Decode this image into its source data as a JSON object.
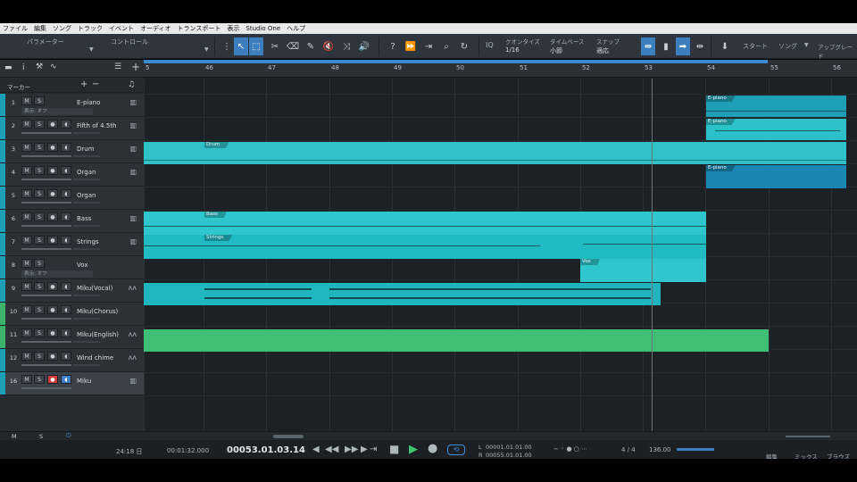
{
  "menu": [
    "ファイル",
    "編集",
    "ソング",
    "トラック",
    "イベント",
    "オーディオ",
    "トランスポート",
    "表示",
    "Studio One",
    "ヘルプ"
  ],
  "toolbar": {
    "parameter_label": "パラメーター",
    "control_label": "コントロール",
    "quantize_label": "クオンタイズ",
    "quantize_value": "1/16",
    "timebase_label": "タイムベース",
    "timebase_value": "小節",
    "snap_label": "スナップ",
    "snap_value": "適応",
    "iq_label": "IQ",
    "start_label": "スタート",
    "song_label": "ソング",
    "upgrade_label": "アップグレード"
  },
  "left_panel": {
    "marker_label": "マーカー",
    "tracks": [
      {
        "num": "1",
        "name": "E-piano",
        "color": "#1aa1b8",
        "sub": "表示: オフ",
        "icon": "keyboard-icon"
      },
      {
        "num": "2",
        "name": "Fifth of 4.5th",
        "color": "#1aa1b8",
        "icon": "keyboard-icon"
      },
      {
        "num": "3",
        "name": "Drum",
        "color": "#1aa1b8",
        "icon": "keyboard-icon"
      },
      {
        "num": "4",
        "name": "Organ",
        "color": "#1aa1b8",
        "icon": "keyboard-icon"
      },
      {
        "num": "5",
        "name": "Organ",
        "color": "#1aa1b8",
        "icon": ""
      },
      {
        "num": "6",
        "name": "Bass",
        "color": "#1aa1b8",
        "icon": "keyboard-icon"
      },
      {
        "num": "7",
        "name": "Strings",
        "color": "#1aa1b8",
        "icon": "keyboard-icon"
      },
      {
        "num": "8",
        "name": "Vox",
        "color": "#1aa1b8",
        "sub": "表示: オフ",
        "icon": ""
      },
      {
        "num": "9",
        "name": "Miku(Vocal)",
        "color": "#1aa1b8",
        "icon": "waveform-icon"
      },
      {
        "num": "10",
        "name": "Miku(Chorus)",
        "color": "#3cb36a",
        "icon": ""
      },
      {
        "num": "11",
        "name": "Miku(English)",
        "color": "#3cb36a",
        "icon": "waveform-icon"
      },
      {
        "num": "12",
        "name": "Wind chime",
        "color": "#1aa1b8",
        "icon": "waveform-icon"
      },
      {
        "num": "16",
        "name": "Miku",
        "color": "#1aa1b8",
        "icon": "keyboard-icon"
      }
    ],
    "footer": {
      "m": "M",
      "s": "S"
    }
  },
  "ruler": {
    "bars": [
      "5",
      "46",
      "47",
      "48",
      "49",
      "50",
      "51",
      "52",
      "53",
      "54",
      "55",
      "56"
    ]
  },
  "clips": {
    "epiano_1": "E-piano",
    "epiano_2": "E-piano",
    "epiano_3": "E-piano",
    "drum": "Drum",
    "bass": "Bass",
    "strings": "Strings",
    "vox": "Vox"
  },
  "transport": {
    "time_small": "24:18 日",
    "seconds": "00:01:32.000",
    "position": "00053.01.03.14",
    "loop_start": "00001.01.01.00",
    "loop_end": "00055.01.01.00",
    "signature": "4 / 4",
    "tempo": "136.00",
    "tab_edit": "編集",
    "tab_mix": "ミックス",
    "tab_browse": "ブラウズ",
    "l_label": "L",
    "r_label": "R"
  },
  "colors": {
    "cyan": "#2fc0c8",
    "cyan_dark": "#1a9bb8",
    "green": "#3fbf74",
    "accent": "#3d7ebf"
  }
}
